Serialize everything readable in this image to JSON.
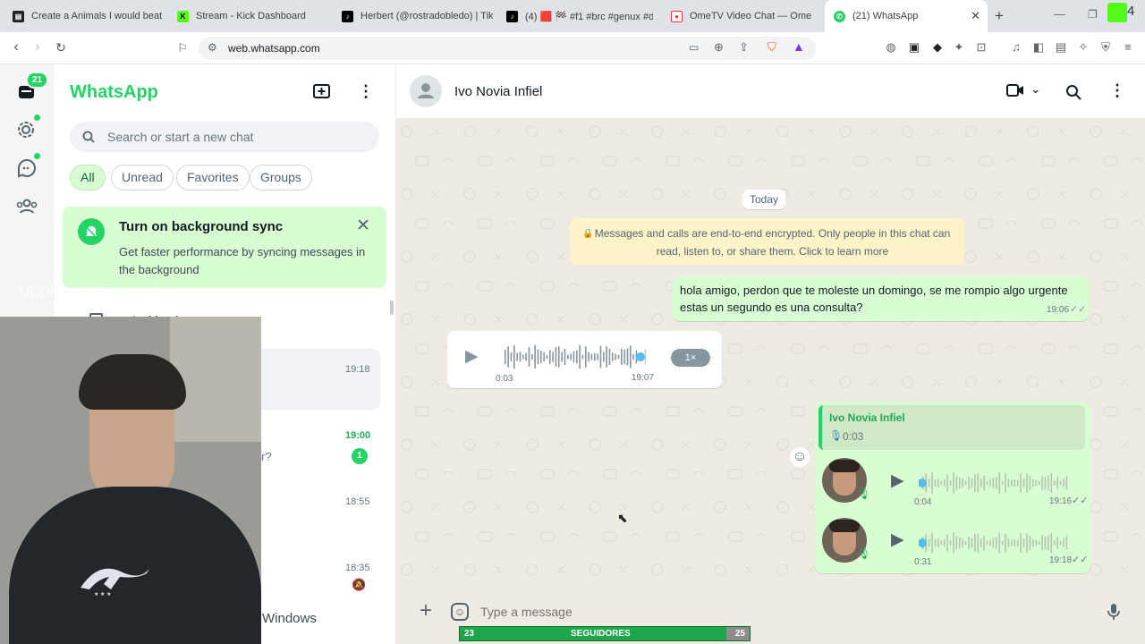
{
  "browser": {
    "tabs": [
      {
        "title": "Create a Animals I would beat in"
      },
      {
        "title": "Stream - Kick Dashboard"
      },
      {
        "title": "Herbert (@rostradobledo) | TikT"
      },
      {
        "title": "(4) 🟥 🏁 #f1 #brc #genux #dis"
      },
      {
        "title": "OmeTV Video Chat — Ome"
      },
      {
        "title": "(21) WhatsApp"
      }
    ],
    "url": "web.whatsapp.com",
    "new_tab": "+",
    "profile_badge": "4"
  },
  "rail": {
    "chats_badge": "21"
  },
  "left": {
    "brand": "WhatsApp",
    "search_placeholder": "Search or start a new chat",
    "filters": [
      "All",
      "Unread",
      "Favorites",
      "Groups"
    ],
    "sync": {
      "title": "Turn on background sync",
      "body": "Get faster performance by syncing messages in the background"
    },
    "archived_label": "Archived",
    "ghost_text": "ULTIMO SUB: No sub's",
    "chats": [
      {
        "time": "19:18",
        "preview": ""
      },
      {
        "time": "19:00",
        "preview": "r?",
        "unread": "1"
      },
      {
        "time": "18:55",
        "preview": ""
      },
      {
        "time": "18:35",
        "preview": ""
      }
    ],
    "footer_fragment": "Windows"
  },
  "chat": {
    "contact_name": "Ivo Novia Infiel",
    "date_chip": "Today",
    "encryption_notice": "Messages and calls are end-to-end encrypted. Only people in this chat can read, listen to, or share them. Click to learn more",
    "messages": [
      {
        "text": "hola amigo, perdon que te moleste un domingo, se me rompio algo urgente estas un segundo es una consulta?",
        "time": "19:06"
      },
      {
        "duration": "0:03",
        "time": "19:07",
        "speed": "1×",
        "progress": 0.95
      },
      {
        "quote_author": "Ivo Novia Infiel",
        "quote_duration": "0:03"
      },
      {
        "duration": "0:04",
        "time": "19:16",
        "progress": 0.0
      },
      {
        "duration": "0:31",
        "time": "19:18",
        "progress": 0.0
      }
    ],
    "composer_placeholder": "Type a message"
  },
  "overlay": {
    "left_count": "23",
    "label": "SEGUIDORES",
    "right_count": "25",
    "fill": 0.92
  },
  "colors": {
    "brand": "#25d366",
    "out_bubble": "#d9fdd3",
    "chat_bg": "#efeae2",
    "tick_blue": "#53bdeb",
    "overlay_green": "#1fa64b"
  }
}
